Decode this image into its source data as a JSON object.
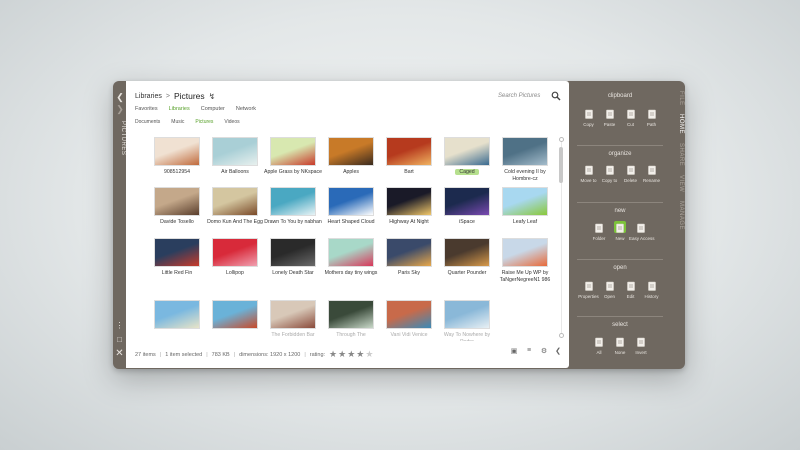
{
  "sidebar": {
    "title": "PICTURES"
  },
  "header": {
    "crumb_root": "Libraries",
    "crumb_sep": ">",
    "crumb_current": "Pictures",
    "search_placeholder": "Search Pictures"
  },
  "locations": [
    "Favorites",
    "Libraries",
    "Computer",
    "Network"
  ],
  "locations_active": "Libraries",
  "libraries": [
    "Documents",
    "Music",
    "Pictures",
    "Videos"
  ],
  "libraries_active": "Pictures",
  "files": [
    {
      "name": "908512954",
      "colors": [
        "#f0e1d2",
        "#c06a3c"
      ]
    },
    {
      "name": "Air Balloons",
      "colors": [
        "#a9cfd6",
        "#e8f0ee"
      ]
    },
    {
      "name": "Apple Grass by NKspace",
      "colors": [
        "#d8e8b0",
        "#c83a2a"
      ]
    },
    {
      "name": "Apples",
      "colors": [
        "#c87a28",
        "#3a2a1e"
      ]
    },
    {
      "name": "Bart",
      "colors": [
        "#b63a1e",
        "#f0b260"
      ]
    },
    {
      "name": "Caged",
      "colors": [
        "#e6e0cc",
        "#3a6a90"
      ],
      "selected": true
    },
    {
      "name": "Cold evening II by Hombre-cz",
      "colors": [
        "#4f7186",
        "#a4bccb"
      ]
    },
    {
      "name": "Davide Tosello",
      "colors": [
        "#c4a88a",
        "#5a3e2c"
      ]
    },
    {
      "name": "Domo Kun And The Egg",
      "colors": [
        "#d4c6a0",
        "#7a4a28"
      ]
    },
    {
      "name": "Drawn To You by nabhan",
      "colors": [
        "#4aa8c2",
        "#e8f4f6"
      ]
    },
    {
      "name": "Heart Shaped Cloud",
      "colors": [
        "#2a6ab8",
        "#ffffff"
      ]
    },
    {
      "name": "Highway At Night",
      "colors": [
        "#1a1a28",
        "#f2c86a"
      ]
    },
    {
      "name": "iSpace",
      "colors": [
        "#1c2a4e",
        "#7a4ab2"
      ]
    },
    {
      "name": "Leafy Leaf",
      "colors": [
        "#a8d8f0",
        "#8ac83a"
      ]
    },
    {
      "name": "Little Red Fin",
      "colors": [
        "#2a3e5e",
        "#c83a2a"
      ]
    },
    {
      "name": "Lollipop",
      "colors": [
        "#d82a3a",
        "#f0a0b0"
      ]
    },
    {
      "name": "Lonely Death Star",
      "colors": [
        "#2a2a2a",
        "#6a6a6a"
      ]
    },
    {
      "name": "Mothers day tiny wings",
      "colors": [
        "#a8d8c8",
        "#d8385a"
      ]
    },
    {
      "name": "Paris Sky",
      "colors": [
        "#3a4a6a",
        "#e8a84a"
      ]
    },
    {
      "name": "Quarter Pounder",
      "colors": [
        "#4a3a2e",
        "#d89a4a"
      ]
    },
    {
      "name": "Raise Me Up WP by TaNgerNegreeN1 986",
      "colors": [
        "#c8d8e8",
        "#e86a3a"
      ]
    },
    {
      "name": "",
      "colors": [
        "#7ab8e0",
        "#e8e4c8"
      ],
      "cut": true
    },
    {
      "name": "",
      "colors": [
        "#6ab2d8",
        "#c84a2a"
      ],
      "cut": true
    },
    {
      "name": "The Forbidden Bar",
      "colors": [
        "#d8c8b8",
        "#8a4a3a"
      ],
      "cut": true
    },
    {
      "name": "Through The",
      "colors": [
        "#3a4a3a",
        "#c8d8c8"
      ],
      "cut": true
    },
    {
      "name": "Vani Vidi Venice",
      "colors": [
        "#c86a4a",
        "#3a8ab8"
      ],
      "cut": true
    },
    {
      "name": "Way To Nowhere by Pedro",
      "colors": [
        "#8ab8d8",
        "#e8f0f4"
      ],
      "cut": true
    }
  ],
  "status": {
    "items": "27 items",
    "selected": "1 item selected",
    "size": "783 KB",
    "dimensions": "dimensions: 1920 x 1200",
    "rating_label": "rating:",
    "rating": 4,
    "rating_max": 5
  },
  "ribbon": {
    "clipboard": {
      "title": "clipboard",
      "buttons": [
        "Copy",
        "Paste",
        "Cut",
        "Path"
      ]
    },
    "organize": {
      "title": "organize",
      "buttons": [
        "Move to",
        "Copy to",
        "Delete",
        "Rename"
      ]
    },
    "new": {
      "title": "new",
      "buttons": [
        "Folder",
        "New",
        "Easy Access"
      ]
    },
    "open": {
      "title": "open",
      "buttons": [
        "Properties",
        "Open",
        "Edit",
        "History"
      ]
    },
    "select": {
      "title": "select",
      "buttons": [
        "All",
        "None",
        "Invert"
      ]
    }
  },
  "vtabs": [
    "FILE",
    "HOME",
    "SHARE",
    "VIEW",
    "MANAGE"
  ],
  "vtabs_active": "HOME",
  "colors": {
    "accent_green": "#59a12b",
    "ribbon_bg": "#6f6860",
    "selected_bg": "#b6e08e"
  }
}
